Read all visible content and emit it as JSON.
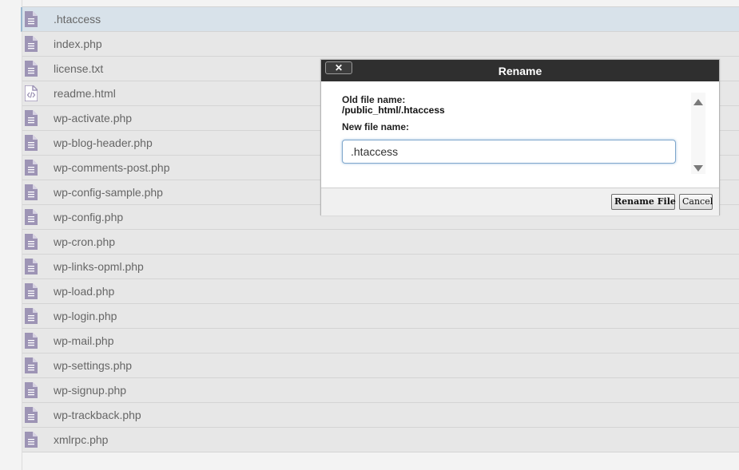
{
  "files": [
    {
      "name": ".htaccess",
      "icon": "text-file-icon",
      "selected": true
    },
    {
      "name": "index.php",
      "icon": "text-file-icon"
    },
    {
      "name": "license.txt",
      "icon": "text-file-icon"
    },
    {
      "name": "readme.html",
      "icon": "html-file-icon"
    },
    {
      "name": "wp-activate.php",
      "icon": "text-file-icon"
    },
    {
      "name": "wp-blog-header.php",
      "icon": "text-file-icon"
    },
    {
      "name": "wp-comments-post.php",
      "icon": "text-file-icon"
    },
    {
      "name": "wp-config-sample.php",
      "icon": "text-file-icon"
    },
    {
      "name": "wp-config.php",
      "icon": "text-file-icon"
    },
    {
      "name": "wp-cron.php",
      "icon": "text-file-icon"
    },
    {
      "name": "wp-links-opml.php",
      "icon": "text-file-icon"
    },
    {
      "name": "wp-load.php",
      "icon": "text-file-icon"
    },
    {
      "name": "wp-login.php",
      "icon": "text-file-icon"
    },
    {
      "name": "wp-mail.php",
      "icon": "text-file-icon"
    },
    {
      "name": "wp-settings.php",
      "icon": "text-file-icon"
    },
    {
      "name": "wp-signup.php",
      "icon": "text-file-icon"
    },
    {
      "name": "wp-trackback.php",
      "icon": "text-file-icon"
    },
    {
      "name": "xmlrpc.php",
      "icon": "text-file-icon"
    }
  ],
  "dialog": {
    "title": "Rename",
    "close_label": "✕",
    "old_label": "Old file name:",
    "old_value": "/public_html/.htaccess",
    "new_label": "New file name:",
    "new_value": ".htaccess",
    "rename_label": "Rename File",
    "cancel_label": "Cancel"
  },
  "colors": {
    "icon": "#9d94b5",
    "title_bar": "#2f2f2f",
    "selected_row": "#d8e2ea"
  }
}
